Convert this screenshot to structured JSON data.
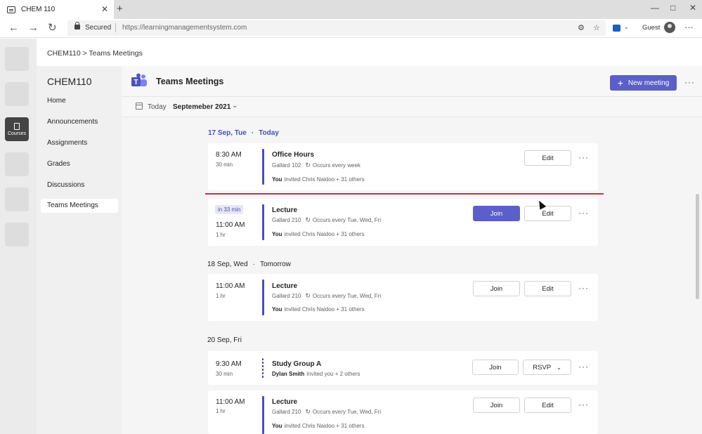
{
  "browser": {
    "tab_title": "CHEM 110",
    "tab_close": "✕",
    "new_tab": "+",
    "secured": "Secured",
    "url": "https://learningmanagementsystem.com",
    "guest": "Guest",
    "icons": [
      "back-icon",
      "forward-icon",
      "refresh-icon",
      "lock-icon",
      "tracking-icon",
      "favorites-icon",
      "extension-icon",
      "profile-icon"
    ]
  },
  "rail": {
    "courses_label": "Courses"
  },
  "breadcrumb": "CHEM110 > Teams Meetings",
  "course": {
    "title": "CHEM110",
    "nav": [
      "Home",
      "Announcements",
      "Assignments",
      "Grades",
      "Discussions",
      "Teams Meetings"
    ],
    "active": "Teams Meetings"
  },
  "teams": {
    "title": "Teams Meetings",
    "new_meeting": "New meeting",
    "today": "Today",
    "month": "Septemeber 2021"
  },
  "days": [
    {
      "date": "17 Sep, Tue",
      "label": "Today"
    },
    {
      "date": "18 Sep, Wed",
      "label": "Tomorrow"
    },
    {
      "date": "20 Sep, Fri",
      "label": ""
    }
  ],
  "meetings": [
    {
      "time": "8:30 AM",
      "duration": "30 min",
      "title": "Office Hours",
      "location": "Gallard 102",
      "recurrence": "Occurs every week",
      "invite_you": "You",
      "invite_text": "invited Chris Naidoo + 31 others",
      "buttons": [
        "Edit"
      ]
    },
    {
      "badge": "in 33 min",
      "time": "11:00 AM",
      "duration": "1 hr",
      "title": "Lecture",
      "location": "Gallard 210",
      "recurrence": "Occurs every Tue, Wed, Fri",
      "invite_you": "You",
      "invite_text": "invited Chris Naidoo + 31 others",
      "buttons": [
        "Join",
        "Edit"
      ]
    },
    {
      "time": "11:00 AM",
      "duration": "1 hr",
      "title": "Lecture",
      "location": "Gallard 210",
      "recurrence": "Occurs every Tue, Wed, Fri",
      "invite_you": "You",
      "invite_text": "invited Chris Naidoo + 31 others",
      "buttons": [
        "Join",
        "Edit"
      ]
    },
    {
      "time": "9:30 AM",
      "duration": "30 min",
      "title": "Study Group A",
      "organizer": "Dylan Smith",
      "invite_text": "invited you + 2 others",
      "buttons": [
        "Join",
        "RSVP"
      ]
    },
    {
      "time": "11:00 AM",
      "duration": "1 hr",
      "title": "Lecture",
      "location": "Gallard 210",
      "recurrence": "Occurs every Tue, Wed, Fri",
      "invite_you": "You",
      "invite_text": "invited Chris Naidoo + 31 others",
      "buttons": [
        "Join",
        "Edit"
      ]
    }
  ],
  "colors": {
    "accent": "#5b5fc7",
    "today": "#464eb8",
    "now_line": "#c4314b"
  }
}
